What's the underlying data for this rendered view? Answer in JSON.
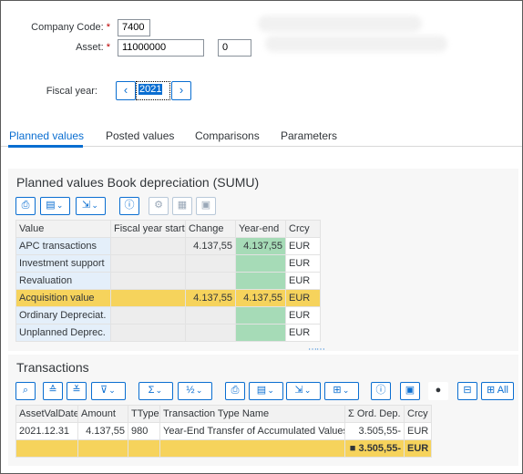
{
  "header": {
    "company_code_label": "Company Code:",
    "company_code_value": "7400",
    "asset_label": "Asset:",
    "asset_value": "11000000",
    "asset_sub_value": "0",
    "required_mark": "*",
    "fiscal_year_label": "Fiscal year:",
    "fiscal_year_value": "2021",
    "prev_glyph": "‹",
    "next_glyph": "›"
  },
  "tabs": [
    {
      "label": "Planned values",
      "active": true
    },
    {
      "label": "Posted values",
      "active": false
    },
    {
      "label": "Comparisons",
      "active": false
    },
    {
      "label": "Parameters",
      "active": false
    }
  ],
  "planned": {
    "title": "Planned values Book depreciation (SUMU)",
    "columns": [
      "Value",
      "Fiscal year start",
      "Change",
      "Year-end",
      "Crcy"
    ],
    "rows": [
      {
        "value": "APC transactions",
        "start": "",
        "change": "4.137,55",
        "end": "4.137,55",
        "crcy": "EUR"
      },
      {
        "value": "Investment support",
        "start": "",
        "change": "",
        "end": "",
        "crcy": "EUR"
      },
      {
        "value": "Revaluation",
        "start": "",
        "change": "",
        "end": "",
        "crcy": "EUR"
      },
      {
        "value": "Acquisition value",
        "start": "",
        "change": "4.137,55",
        "end": "4.137,55",
        "crcy": "EUR"
      },
      {
        "value": "Ordinary Depreciat.",
        "start": "",
        "change": "",
        "end": "",
        "crcy": "EUR"
      },
      {
        "value": "Unplanned Deprec.",
        "start": "",
        "change": "",
        "end": "",
        "crcy": "EUR"
      }
    ],
    "splitter_glyph": "⋯⋯"
  },
  "transactions": {
    "title": "Transactions",
    "columns": [
      "AssetValDate",
      "Amount",
      "TType",
      "Transaction Type Name",
      "Σ Ord. Dep.",
      "Crcy"
    ],
    "rows": [
      {
        "date": "2021.12.31",
        "amount": "4.137,55",
        "ttype": "980",
        "name": "Year-End Transfer of Accumulated Values",
        "ord_dep": "3.505,55-",
        "crcy": "EUR"
      }
    ],
    "total": {
      "marker": "■",
      "ord_dep": "3.505,55-",
      "crcy": "EUR"
    },
    "all_label": "All"
  },
  "colors": {
    "accent": "#0a6ed1",
    "highlight_row": "#f6d35c",
    "green_cell": "#a6dbb7",
    "row_header": "#e4effa"
  }
}
